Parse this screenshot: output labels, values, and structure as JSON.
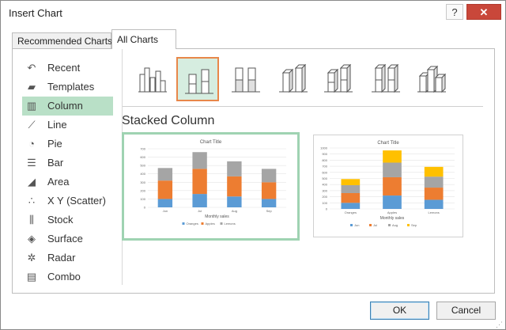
{
  "window": {
    "title": "Insert Chart",
    "help": "?",
    "close": "✕"
  },
  "tabs": [
    {
      "label": "Recommended Charts",
      "active": false
    },
    {
      "label": "All Charts",
      "active": true
    }
  ],
  "sidebar": {
    "items": [
      {
        "label": "Recent",
        "icon": "recent-icon",
        "glyph": "↶"
      },
      {
        "label": "Templates",
        "icon": "templates-folder-icon",
        "glyph": "▰"
      },
      {
        "label": "Column",
        "icon": "column-chart-icon",
        "glyph": "▥",
        "selected": true
      },
      {
        "label": "Line",
        "icon": "line-chart-icon",
        "glyph": "⟋"
      },
      {
        "label": "Pie",
        "icon": "pie-chart-icon",
        "glyph": "◔"
      },
      {
        "label": "Bar",
        "icon": "bar-chart-icon",
        "glyph": "☰"
      },
      {
        "label": "Area",
        "icon": "area-chart-icon",
        "glyph": "◢"
      },
      {
        "label": "X Y (Scatter)",
        "icon": "scatter-chart-icon",
        "glyph": "∴"
      },
      {
        "label": "Stock",
        "icon": "stock-chart-icon",
        "glyph": "⫼"
      },
      {
        "label": "Surface",
        "icon": "surface-chart-icon",
        "glyph": "◈"
      },
      {
        "label": "Radar",
        "icon": "radar-chart-icon",
        "glyph": "✲"
      },
      {
        "label": "Combo",
        "icon": "combo-chart-icon",
        "glyph": "▤"
      }
    ]
  },
  "subtypes": {
    "items": [
      {
        "name": "clustered-column"
      },
      {
        "name": "stacked-column",
        "selected": true
      },
      {
        "name": "100-percent-stacked-column"
      },
      {
        "name": "3d-clustered-column"
      },
      {
        "name": "3d-stacked-column"
      },
      {
        "name": "3d-100-percent-stacked-column"
      },
      {
        "name": "3d-column"
      }
    ],
    "selected_title": "Stacked Column"
  },
  "chart_data": [
    {
      "type": "bar",
      "stacked": true,
      "title": "Chart Title",
      "xlabel": "Monthly sales",
      "ylim": [
        0,
        700
      ],
      "yticks": [
        0,
        100,
        200,
        300,
        400,
        500,
        600,
        700
      ],
      "categories": [
        "Jun",
        "Jul",
        "Aug",
        "Sep"
      ],
      "series": [
        {
          "name": "Oranges",
          "color": "#5b9bd5",
          "values": [
            100,
            160,
            130,
            100
          ]
        },
        {
          "name": "Apples",
          "color": "#ed7d31",
          "values": [
            220,
            300,
            240,
            200
          ]
        },
        {
          "name": "Lemons",
          "color": "#a5a5a5",
          "values": [
            150,
            200,
            180,
            160
          ]
        }
      ],
      "legend": "bottom"
    },
    {
      "type": "bar",
      "stacked": true,
      "title": "Chart Title",
      "xlabel": "Monthly sales",
      "ylim": [
        0,
        1000
      ],
      "yticks": [
        0,
        100,
        200,
        300,
        400,
        500,
        600,
        700,
        800,
        900,
        1000
      ],
      "categories": [
        "Oranges",
        "Apples",
        "Lemons"
      ],
      "series": [
        {
          "name": "Jun",
          "color": "#5b9bd5",
          "values": [
            100,
            220,
            150
          ]
        },
        {
          "name": "Jul",
          "color": "#ed7d31",
          "values": [
            160,
            300,
            200
          ]
        },
        {
          "name": "Aug",
          "color": "#a5a5a5",
          "values": [
            130,
            240,
            180
          ]
        },
        {
          "name": "Sep",
          "color": "#ffc000",
          "values": [
            100,
            200,
            160
          ]
        }
      ],
      "legend": "bottom"
    }
  ],
  "footer": {
    "ok": "OK",
    "cancel": "Cancel"
  }
}
